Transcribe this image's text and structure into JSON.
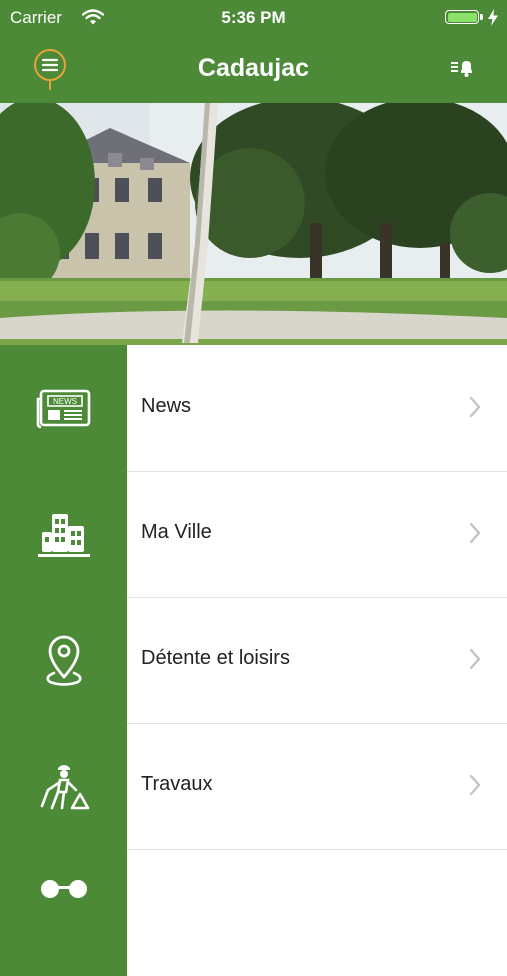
{
  "status_bar": {
    "carrier": "Carrier",
    "time": "5:36 PM"
  },
  "nav": {
    "title": "Cadaujac",
    "left_icon": "menu-icon",
    "right_icon": "notification-bell-list-icon"
  },
  "hero": {
    "image": "chateau-park-photo"
  },
  "menu": [
    {
      "label": "News",
      "icon": "newspaper-icon"
    },
    {
      "label": "Ma Ville",
      "icon": "city-buildings-icon"
    },
    {
      "label": "Détente et loisirs",
      "icon": "location-pin-icon"
    },
    {
      "label": "Travaux",
      "icon": "worker-icon"
    },
    {
      "label": "",
      "icon": "glasses-icon"
    }
  ],
  "colors": {
    "primary": "#4c8a38",
    "battery": "#8be26a",
    "chevron": "#c4c4c4"
  }
}
